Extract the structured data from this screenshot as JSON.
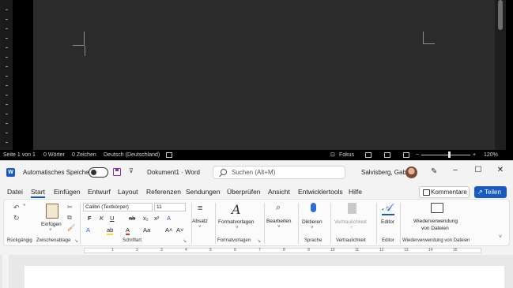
{
  "dark_window": {
    "status": {
      "page": "Seite 1 von 1",
      "words": "0 Wörter",
      "chars": "0 Zeichen",
      "language": "Deutsch (Deutschland)",
      "focus": "Fokus",
      "zoom": "120%"
    }
  },
  "titlebar": {
    "autosave_label": "Automatisches Speichern",
    "autosave_state": "Aus",
    "doc_title": "Dokument1 · Word",
    "search_placeholder": "Suchen (Alt+M)",
    "user_name": "Salvisberg, Gaby"
  },
  "menu": {
    "tabs": [
      "Datei",
      "Start",
      "Einfügen",
      "Entwurf",
      "Layout",
      "Referenzen",
      "Sendungen",
      "Überprüfen",
      "Ansicht",
      "Entwicklertools",
      "Hilfe"
    ],
    "comments": "Kommentare",
    "share": "Teilen"
  },
  "ribbon": {
    "groups": {
      "undo": "Rückgängig",
      "clipboard": "Zwischenablage",
      "font": "Schriftart",
      "paragraph": "Absatz",
      "styles": "Formatvorlagen",
      "voice": "Sprache",
      "confidentiality": "Vertraulichkeit",
      "editor": "Editor",
      "reuse": "Wiederverwendung von Dateien"
    },
    "paste": "Einfügen",
    "font_name": "Calibri (Textkörper)",
    "font_size": "11",
    "paragraph_btn": "Absatz",
    "styles_btn": "Formatvorlagen",
    "editing_btn": "Bearbeiten",
    "dictate_btn": "Diktieren",
    "confidentiality_btn": "Vertraulichkeit",
    "editor_btn": "Editor",
    "reuse_btn_line1": "Wiederverwendung",
    "reuse_btn_line2": "von Dateien",
    "fmt_row1": [
      "F",
      "K",
      "U",
      "ab",
      "x₂",
      "x²",
      "A"
    ],
    "fmt_row2": [
      "A",
      "ab",
      "A",
      "Aa",
      "A˄",
      "A˅"
    ]
  },
  "ruler_numbers": [
    "1",
    "2",
    "3",
    "4",
    "5",
    "6",
    "7",
    "8",
    "9",
    "10",
    "11",
    "12",
    "13",
    "14",
    "15"
  ]
}
